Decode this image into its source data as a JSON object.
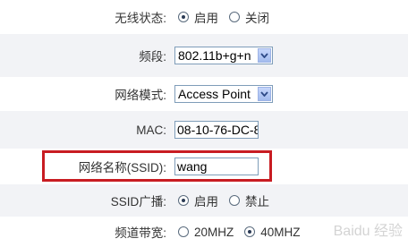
{
  "wireless_status": {
    "label": "无线状态:",
    "options": [
      "启用",
      "关闭"
    ],
    "selected": "启用"
  },
  "band": {
    "label": "频段:",
    "value": "802.11b+g+n"
  },
  "network_mode": {
    "label": "网络模式:",
    "value": "Access Point"
  },
  "mac": {
    "label": "MAC:",
    "value": "08-10-76-DC-8"
  },
  "ssid": {
    "label": "网络名称(SSID):",
    "value": "wang"
  },
  "ssid_broadcast": {
    "label": "SSID广播:",
    "options": [
      "启用",
      "禁止"
    ],
    "selected": "启用"
  },
  "channel_bandwidth": {
    "label": "频道带宽:",
    "options": [
      "20MHZ",
      "40MHZ"
    ],
    "selected": "40MHZ"
  },
  "watermark": "Baidu 经验",
  "colors": {
    "highlight": "#c81c22",
    "row_shade": "#f2f3f6"
  },
  "icons": [
    "dropdown-arrow-icon",
    "radio-icon"
  ]
}
